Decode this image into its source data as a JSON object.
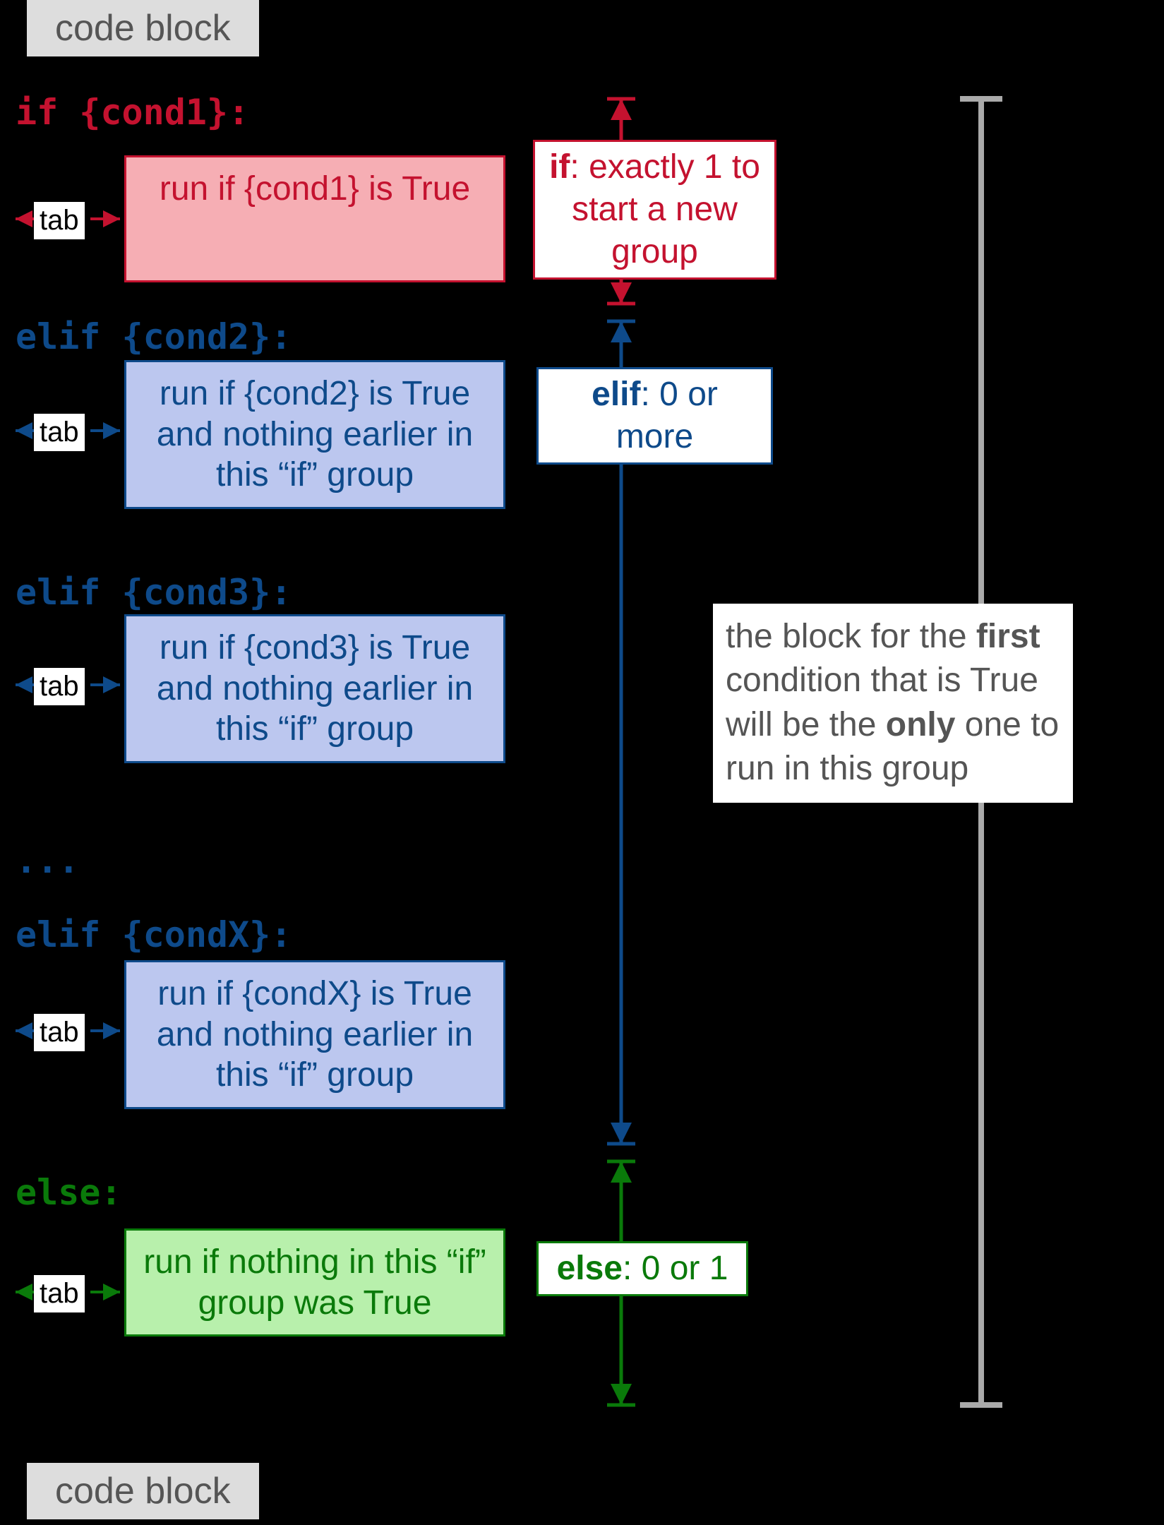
{
  "labels": {
    "codeblock_top": "code block",
    "codeblock_bottom": "code block",
    "tab": "tab",
    "dots": "..."
  },
  "keywords": {
    "if": "if {cond1}:",
    "elif2": "elif {cond2}:",
    "elif3": "elif {cond3}:",
    "elifX": "elif {condX}:",
    "else": "else:"
  },
  "runboxes": {
    "if": "run if {cond1} is True",
    "elif2": "run if {cond2} is True and nothing earlier in this “if” group",
    "elif3": "run if {cond3} is True and nothing earlier in this “if” group",
    "elifX": "run if {condX} is True and nothing earlier in this “if” group",
    "else": "run if nothing in this “if” group was True"
  },
  "annots": {
    "if_kw": "if",
    "if_rest": ": exactly 1 to start a new group",
    "elif_kw": "elif",
    "elif_rest": ": 0 or more",
    "else_kw": "else",
    "else_rest": ": 0 or 1"
  },
  "side_html": "the block for the <b>first</b> condition that is True will be the <b>only</b> one to run in this group",
  "colors": {
    "red": "#c4122f",
    "blue": "#0e4a8a",
    "green": "#0a7a0a",
    "gray": "#aaaaaa"
  }
}
